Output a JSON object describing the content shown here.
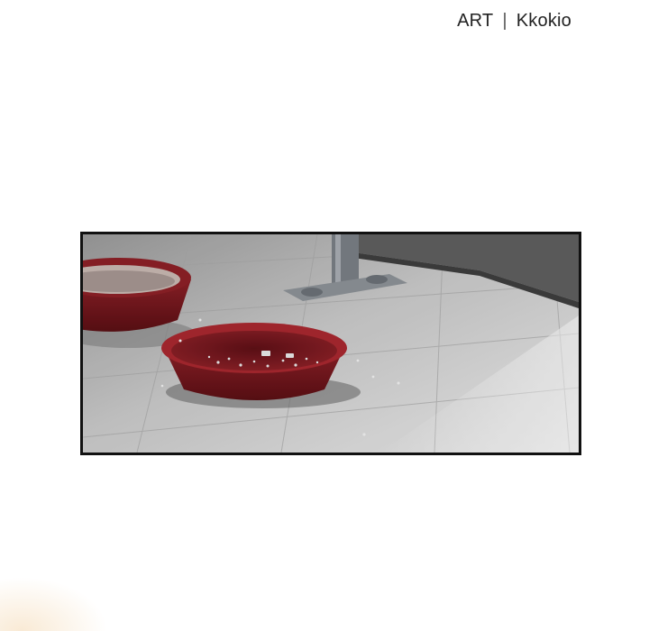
{
  "credit": {
    "role": "ART",
    "separator": "|",
    "artist": "Kkokio"
  },
  "panel": {
    "bowl_color": "#8b1d22",
    "floor_color": "#d9d9d9",
    "shadow_color": "#6e6e6e"
  }
}
